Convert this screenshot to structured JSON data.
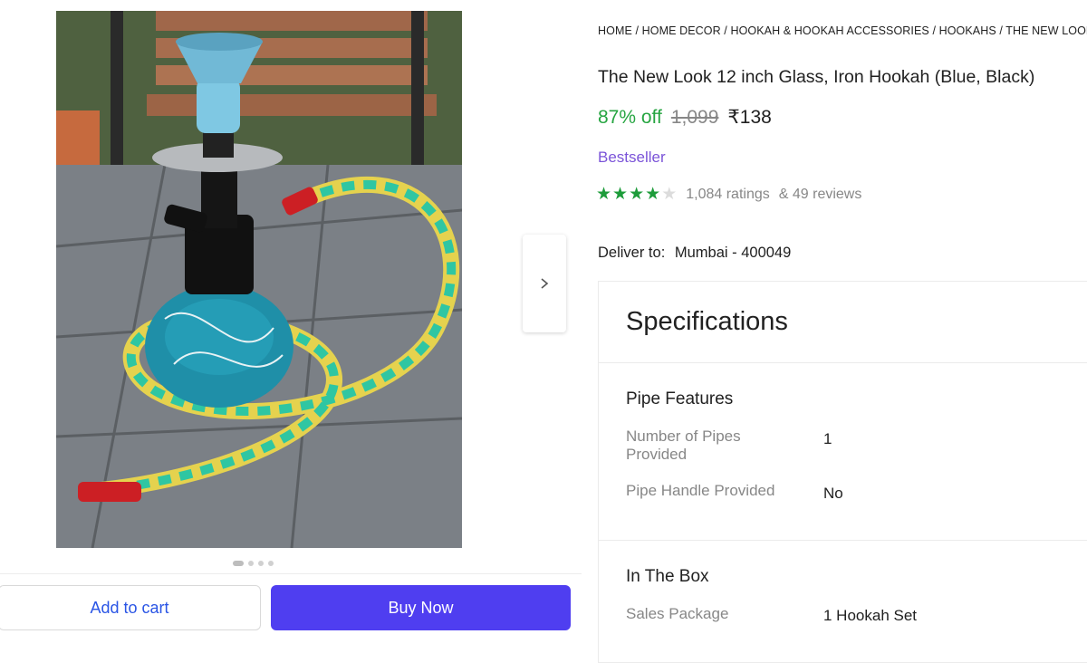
{
  "breadcrumb": "HOME / HOME DECOR / HOOKAH & HOOKAH ACCESSORIES / HOOKAHS / THE NEW LOOK HOOKAHS",
  "product": {
    "title": "The New Look 12 inch Glass, Iron Hookah (Blue, Black)",
    "discount": "87% off",
    "mrp": "1,099",
    "price": "₹138",
    "badge": "Bestseller",
    "rating_stars": 4,
    "ratings": "1,084 ratings",
    "reviews": "& 49 reviews"
  },
  "delivery": {
    "label": "Deliver to:",
    "location": "Mumbai - 400049"
  },
  "gallery": {
    "image_count": 4,
    "active_index": 0,
    "next_icon": "chevron-right-icon"
  },
  "actions": {
    "add_to_cart": "Add to cart",
    "buy_now": "Buy Now"
  },
  "specifications": {
    "title": "Specifications",
    "groups": [
      {
        "name": "Pipe Features",
        "rows": [
          {
            "key": "Number of Pipes Provided",
            "value": "1"
          },
          {
            "key": "Pipe Handle Provided",
            "value": "No"
          }
        ]
      },
      {
        "name": "In The Box",
        "rows": [
          {
            "key": "Sales Package",
            "value": "1 Hookah Set"
          }
        ]
      }
    ]
  },
  "colors": {
    "discount": "#26a541",
    "bestseller": "#7b54d8",
    "buy_button": "#4f3ef0",
    "star": "#1d9c3a"
  }
}
